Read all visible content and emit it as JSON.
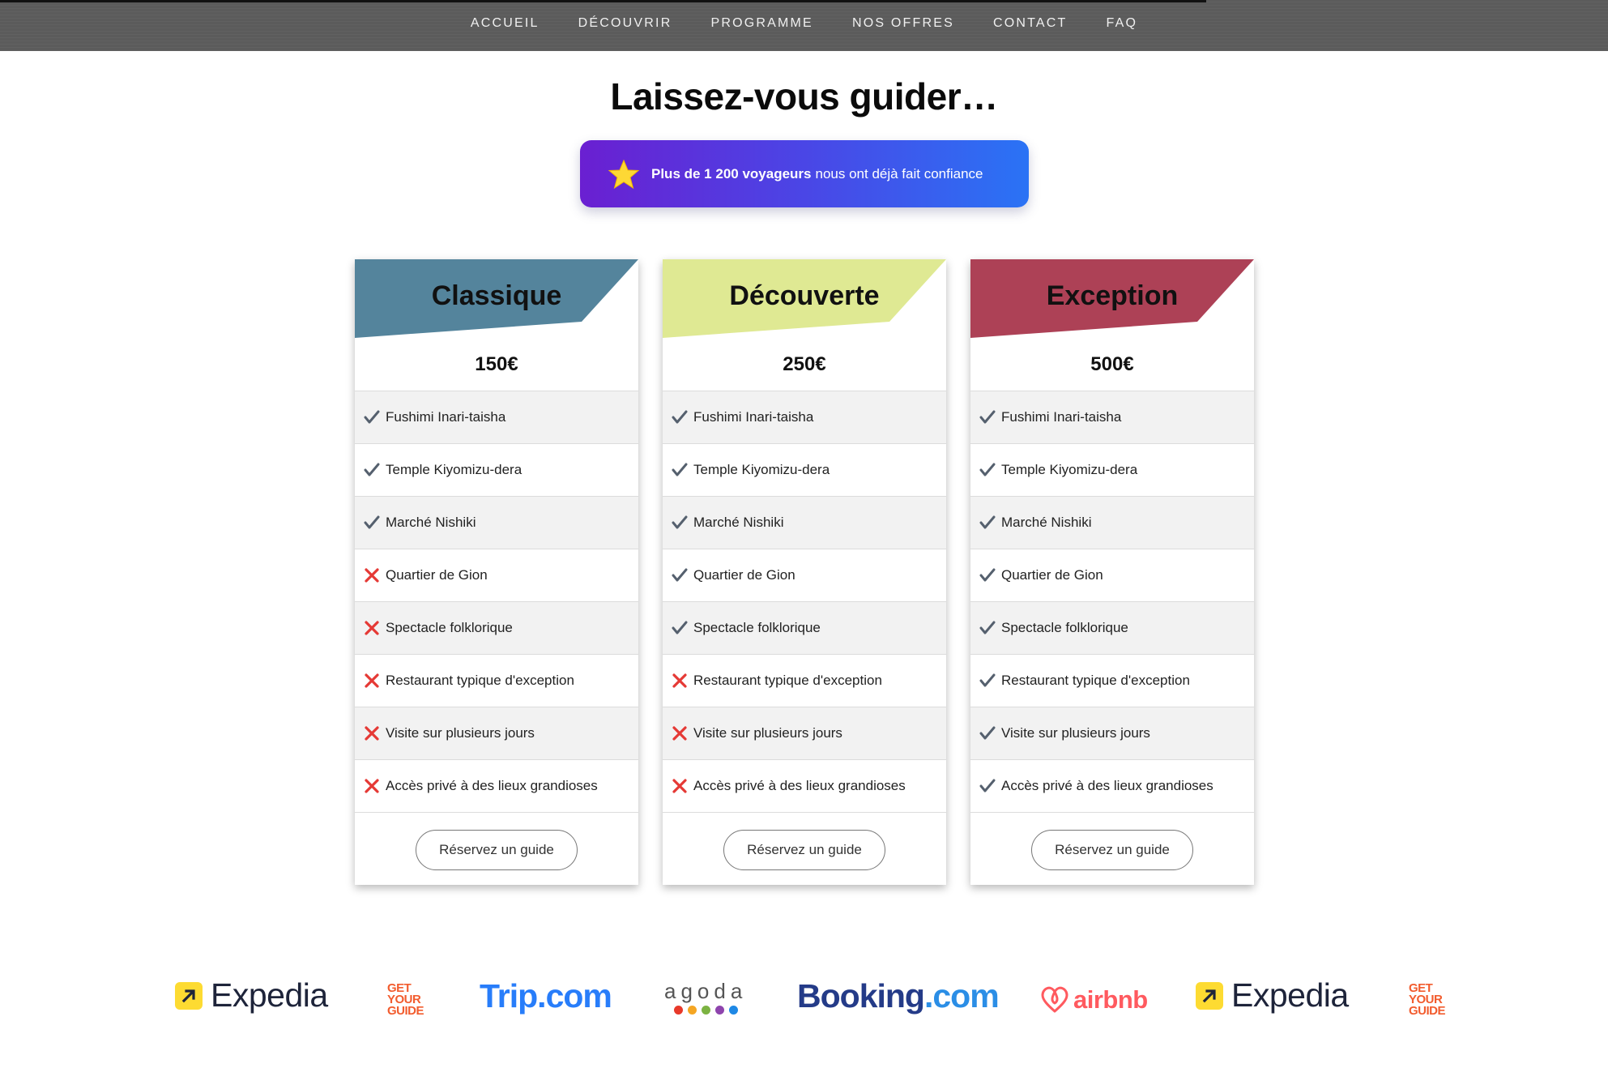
{
  "nav": {
    "items": [
      "ACCUEIL",
      "DÉCOUVRIR",
      "PROGRAMME",
      "NOS OFFRES",
      "CONTACT",
      "FAQ"
    ]
  },
  "header": {
    "title": "Laissez-vous guider…",
    "trust_strong": "Plus de 1 200 voyageurs",
    "trust_rest": "nous ont déjà fait confiance",
    "trust_icon": "star-icon"
  },
  "plans": [
    {
      "name": "Classique",
      "price": "150€",
      "color": "#54849c",
      "button": "Réservez un guide",
      "features": [
        {
          "label": "Fushimi Inari-taisha",
          "included": true
        },
        {
          "label": "Temple Kiyomizu-dera",
          "included": true
        },
        {
          "label": "Marché Nishiki",
          "included": true
        },
        {
          "label": "Quartier de Gion",
          "included": false
        },
        {
          "label": "Spectacle folklorique",
          "included": false
        },
        {
          "label": "Restaurant typique d'exception",
          "included": false
        },
        {
          "label": "Visite sur plusieurs jours",
          "included": false
        },
        {
          "label": "Accès privé à des lieux grandioses",
          "included": false
        }
      ]
    },
    {
      "name": "Découverte",
      "price": "250€",
      "color": "#dfe993",
      "button": "Réservez un guide",
      "features": [
        {
          "label": "Fushimi Inari-taisha",
          "included": true
        },
        {
          "label": "Temple Kiyomizu-dera",
          "included": true
        },
        {
          "label": "Marché Nishiki",
          "included": true
        },
        {
          "label": "Quartier de Gion",
          "included": true
        },
        {
          "label": "Spectacle folklorique",
          "included": true
        },
        {
          "label": "Restaurant typique d'exception",
          "included": false
        },
        {
          "label": "Visite sur plusieurs jours",
          "included": false
        },
        {
          "label": "Accès privé à des lieux grandioses",
          "included": false
        }
      ]
    },
    {
      "name": "Exception",
      "price": "500€",
      "color": "#ad4156",
      "button": "Réservez un guide",
      "features": [
        {
          "label": "Fushimi Inari-taisha",
          "included": true
        },
        {
          "label": "Temple Kiyomizu-dera",
          "included": true
        },
        {
          "label": "Marché Nishiki",
          "included": true
        },
        {
          "label": "Quartier de Gion",
          "included": true
        },
        {
          "label": "Spectacle folklorique",
          "included": true
        },
        {
          "label": "Restaurant typique d'exception",
          "included": true
        },
        {
          "label": "Visite sur plusieurs jours",
          "included": true
        },
        {
          "label": "Accès privé à des lieux grandioses",
          "included": true
        }
      ]
    }
  ],
  "partners": {
    "expedia": "Expedia",
    "gyg": [
      "GET",
      "YOUR",
      "GUIDE"
    ],
    "trip": "Trip.com",
    "agoda": "agoda",
    "booking_a": "Booking",
    "booking_b": ".com",
    "airbnb": "airbnb"
  }
}
